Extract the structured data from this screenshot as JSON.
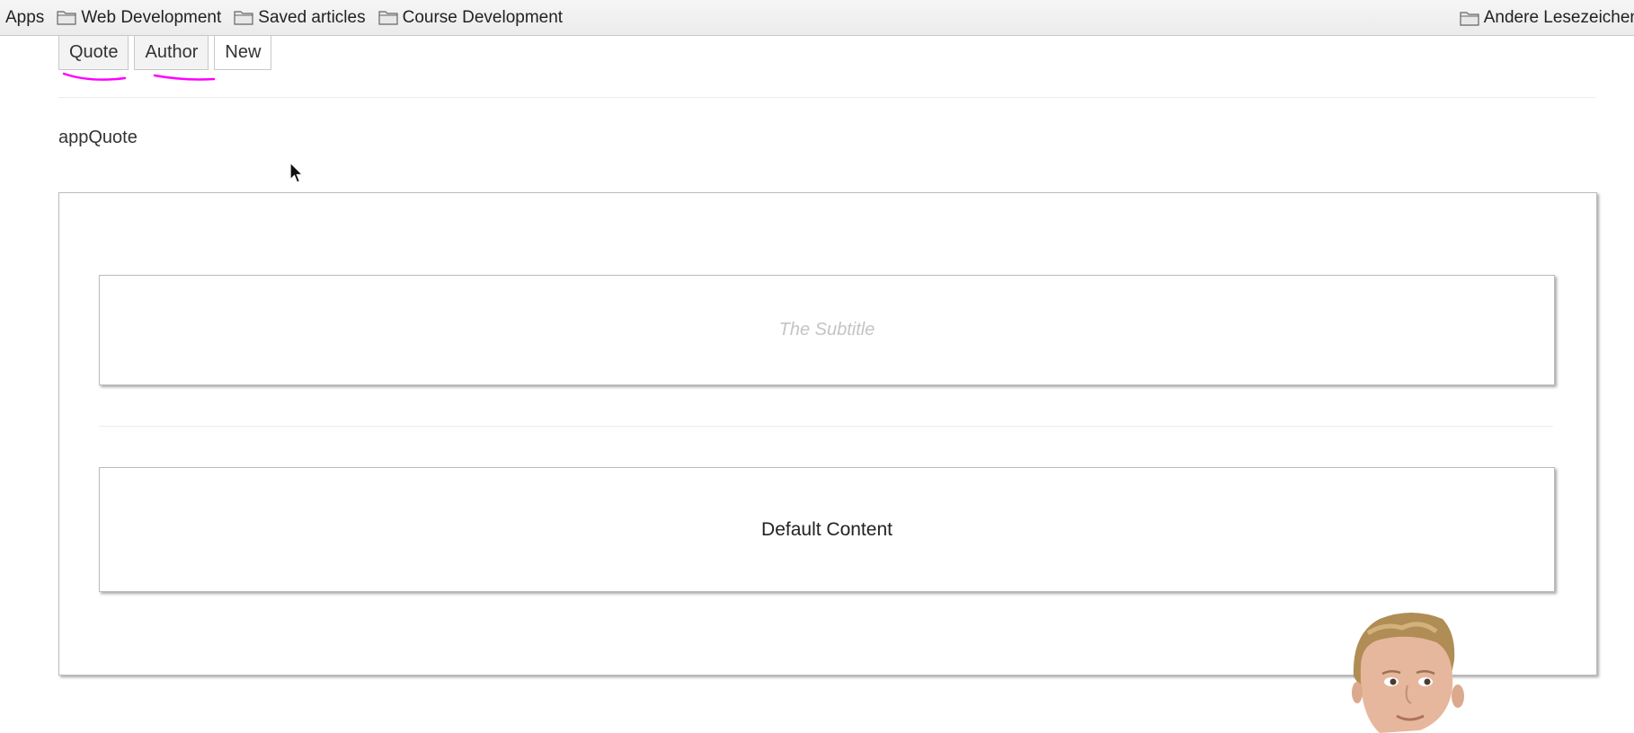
{
  "bookmarks": {
    "apps_label": "Apps",
    "items": [
      "Web Development",
      "Saved articles",
      "Course Development"
    ],
    "other_label": "Andere Lesezeichen"
  },
  "tabs": [
    "Quote",
    "Author",
    "New"
  ],
  "component_title": "appQuote",
  "subtitle": "The Subtitle",
  "content": "Default Content",
  "colors": {
    "annotation_underline": "#ff00ff",
    "subtitle_text": "#c4c4c4"
  }
}
